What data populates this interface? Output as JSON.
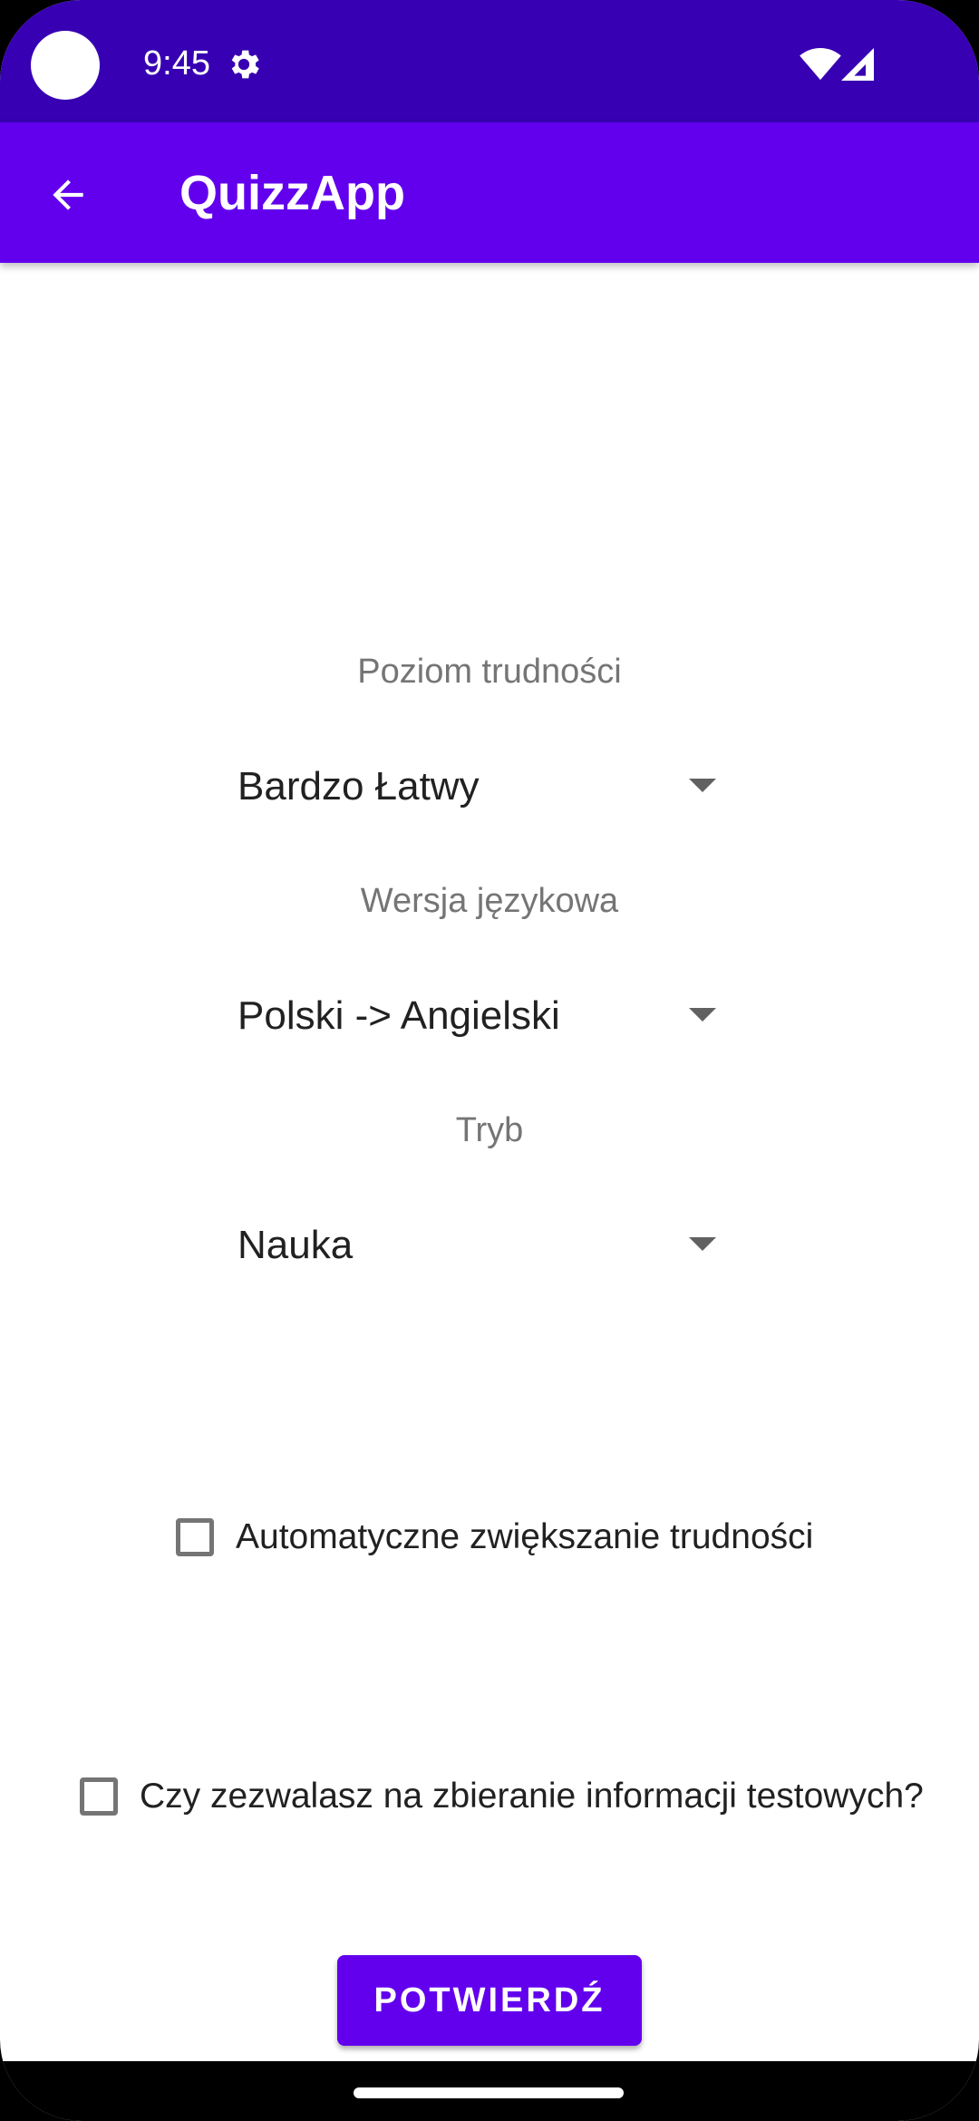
{
  "status_bar": {
    "time": "9:45",
    "icons": [
      "gear-icon",
      "wifi-icon",
      "signal-icon"
    ],
    "background": "#3700b3"
  },
  "app_bar": {
    "title": "QuizzApp",
    "back_icon": "arrow-back-icon",
    "background": "#6200ee"
  },
  "form": {
    "difficulty": {
      "label": "Poziom trudności",
      "value": "Bardzo Łatwy"
    },
    "language": {
      "label": "Wersja językowa",
      "value": "Polski -> Angielski"
    },
    "mode": {
      "label": "Tryb",
      "value": "Nauka"
    },
    "auto_difficulty": {
      "label": "Automatyczne zwiększanie trudności",
      "checked": false
    },
    "test_data_consent": {
      "label": "Czy zezwalasz na zbieranie informacji testowych?",
      "checked": false
    },
    "confirm_label": "POTWIERDŹ"
  },
  "colors": {
    "accent": "#6200ee",
    "label_gray": "#757575"
  }
}
